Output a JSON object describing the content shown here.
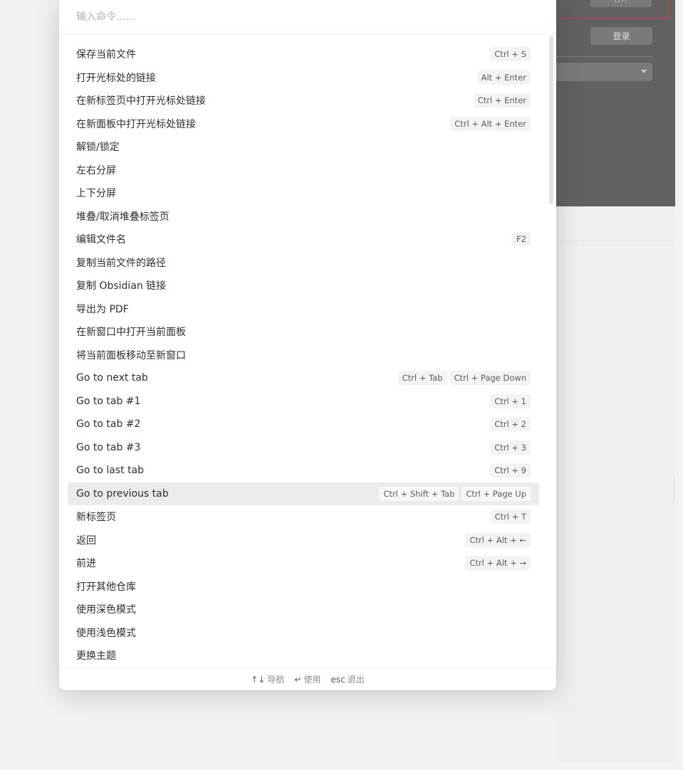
{
  "search": {
    "placeholder": "输入命令……",
    "value": ""
  },
  "background": {
    "top_button": "打开",
    "login_button": "登录"
  },
  "commands": [
    {
      "label": "保存当前文件",
      "hotkeys": [
        "Ctrl + S"
      ]
    },
    {
      "label": "打开光标处的链接",
      "hotkeys": [
        "Alt + Enter"
      ]
    },
    {
      "label": "在新标签页中打开光标处链接",
      "hotkeys": [
        "Ctrl + Enter"
      ]
    },
    {
      "label": "在新面板中打开光标处链接",
      "hotkeys": [
        "Ctrl + Alt + Enter"
      ]
    },
    {
      "label": "解锁/锁定",
      "hotkeys": []
    },
    {
      "label": "左右分屏",
      "hotkeys": []
    },
    {
      "label": "上下分屏",
      "hotkeys": []
    },
    {
      "label": "堆叠/取消堆叠标签页",
      "hotkeys": []
    },
    {
      "label": "编辑文件名",
      "hotkeys": [
        "F2"
      ]
    },
    {
      "label": "复制当前文件的路径",
      "hotkeys": []
    },
    {
      "label": "复制 Obsidian 链接",
      "hotkeys": []
    },
    {
      "label": "导出为 PDF",
      "hotkeys": []
    },
    {
      "label": "在新窗口中打开当前面板",
      "hotkeys": []
    },
    {
      "label": "将当前面板移动至新窗口",
      "hotkeys": []
    },
    {
      "label": "Go to next tab",
      "hotkeys": [
        "Ctrl + Tab",
        "Ctrl + Page Down"
      ]
    },
    {
      "label": "Go to tab #1",
      "hotkeys": [
        "Ctrl + 1"
      ]
    },
    {
      "label": "Go to tab #2",
      "hotkeys": [
        "Ctrl + 2"
      ]
    },
    {
      "label": "Go to tab #3",
      "hotkeys": [
        "Ctrl + 3"
      ]
    },
    {
      "label": "Go to last tab",
      "hotkeys": [
        "Ctrl + 9"
      ]
    },
    {
      "label": "Go to previous tab",
      "hotkeys": [
        "Ctrl + Shift + Tab",
        "Ctrl + Page Up"
      ],
      "selected": true
    },
    {
      "label": "新标签页",
      "hotkeys": [
        "Ctrl + T"
      ]
    },
    {
      "label": "返回",
      "hotkeys": [
        "Ctrl + Alt + ←"
      ]
    },
    {
      "label": "前进",
      "hotkeys": [
        "Ctrl + Alt + →"
      ]
    },
    {
      "label": "打开其他仓库",
      "hotkeys": []
    },
    {
      "label": "使用深色模式",
      "hotkeys": []
    },
    {
      "label": "使用浅色模式",
      "hotkeys": []
    },
    {
      "label": "更换主题",
      "hotkeys": []
    }
  ],
  "footer": {
    "navigate_key": "↑↓",
    "navigate_label": "导航",
    "use_key": "↵",
    "use_label": "使用",
    "exit_key": "esc",
    "exit_label": "退出"
  }
}
